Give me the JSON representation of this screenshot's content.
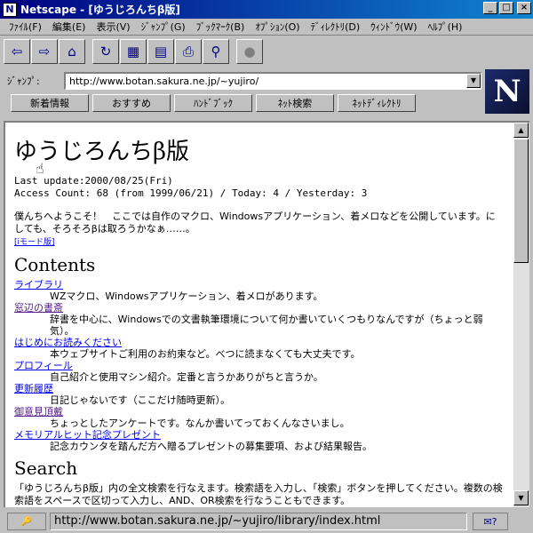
{
  "window": {
    "title": "Netscape - [ゆうじろんちβ版]",
    "buttons": [
      "_",
      "□",
      "×"
    ]
  },
  "menubar": [
    "ﾌｧｲﾙ(F)",
    "編集(E)",
    "表示(V)",
    "ｼﾞｬﾝﾌﾟ(G)",
    "ﾌﾞｯｸﾏｰｸ(B)",
    "ｵﾌﾟｼｮﾝ(O)",
    "ﾃﾞｨﾚｸﾄﾘ(D)",
    "ｳｨﾝﾄﾞｳ(W)",
    "ﾍﾙﾌﾟ(H)"
  ],
  "toolbar": {
    "back": "⇦",
    "forward": "⇨",
    "home": "⌂",
    "reload": "↻",
    "images": "▦",
    "open": "▤",
    "print": "⎙",
    "find": "⚲",
    "stop": "●"
  },
  "jump": {
    "label": "ｼﾞｬﾝﾌﾟ:",
    "url": "http://www.botan.sakura.ne.jp/~yujiro/"
  },
  "directory_buttons": [
    "新着情報",
    "おすすめ",
    "ﾊﾝﾄﾞﾌﾞｯｸ",
    "ﾈｯﾄ検索",
    "ﾈｯﾄﾃﾞｨﾚｸﾄﾘ"
  ],
  "logo": "N",
  "page": {
    "heading": "ゆうじろんちβ版",
    "last_update": "Last update:2000/08/25(Fri)",
    "access_count": "Access Count: 68 (from 1999/06/21) / Today: 4 / Yesterday: 3",
    "intro": "僕んちへようこそ！　ここでは自作のマクロ、Windowsアプリケーション、着メロなどを公開しています。にしても、そろそろβは取ろうかなぁ……。",
    "imode_link": "[iモード版]",
    "contents_heading": "Contents",
    "contents": [
      {
        "link": "ライブラリ",
        "desc": "WZマクロ、Windowsアプリケーション、着メロがあります。"
      },
      {
        "link": "窓辺の書斎",
        "desc": "辞書を中心に、Windowsでの文書執筆環境について何か書いていくつもりなんですが（ちょっと弱気）。"
      },
      {
        "link": "はじめにお読みください",
        "desc": "本ウェブサイトご利用のお約束など。べつに読まなくても大丈夫です。"
      },
      {
        "link": "プロフィール",
        "desc": "自己紹介と使用マシン紹介。定番と言うかありがちと言うか。"
      },
      {
        "link": "更新履歴",
        "desc": "日記じゃないです（ここだけ随時更新）。"
      },
      {
        "link": "御意見頂戴",
        "desc": "ちょっとしたアンケートです。なんか書いてっておくんなさいまし。"
      },
      {
        "link": "メモリアルヒット記念プレゼント",
        "desc": "記念カウンタを踏んだ方へ贈るプレゼントの募集要項、および結果報告。"
      }
    ],
    "search_heading": "Search",
    "search_text": "「ゆうじろんちβ版」内の全文検索を行なえます。検索語を入力し、「検索」ボタンを押してください。複数の検索語をスペースで区切って入力し、AND、OR検索を行なうこともできます。"
  },
  "status": {
    "url": "http://www.botan.sakura.ne.jp/~yujiro/library/index.html",
    "mail": "✉?"
  }
}
